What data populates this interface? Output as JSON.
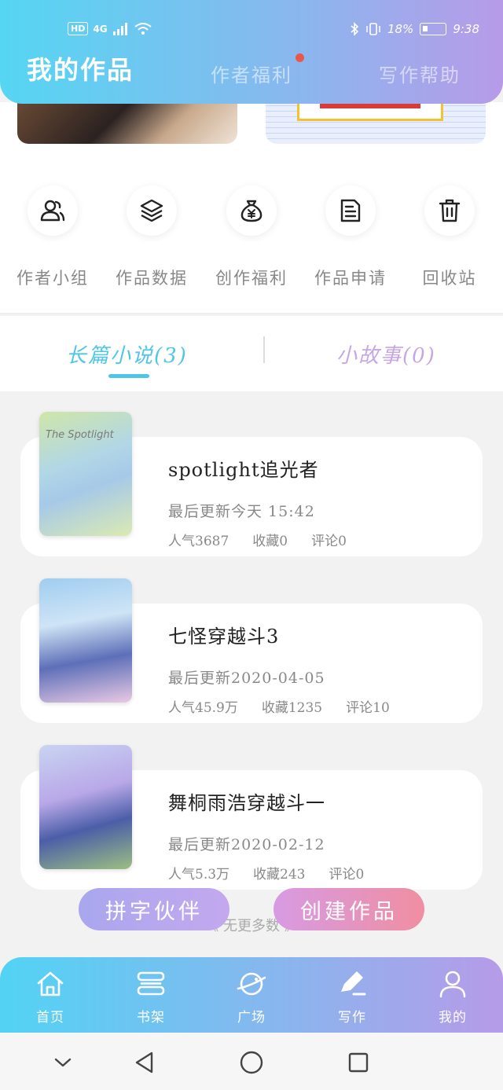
{
  "status_bar": {
    "network_badge": "HD",
    "network_type": "4G",
    "battery_percent": "18%",
    "time": "9:38"
  },
  "header": {
    "tabs": [
      {
        "label": "我的作品",
        "active": true
      },
      {
        "label": "作者福利",
        "active": false,
        "has_dot": true
      },
      {
        "label": "写作帮助",
        "active": false
      }
    ]
  },
  "shortcuts": [
    {
      "label": "作者小组",
      "icon": "users-icon"
    },
    {
      "label": "作品数据",
      "icon": "layers-icon"
    },
    {
      "label": "创作福利",
      "icon": "money-bag-icon"
    },
    {
      "label": "作品申请",
      "icon": "document-icon"
    },
    {
      "label": "回收站",
      "icon": "trash-icon"
    }
  ],
  "subtabs": [
    {
      "label": "长篇小说(3)",
      "active": true
    },
    {
      "label": "小故事(0)",
      "active": false
    }
  ],
  "works": [
    {
      "title": "spotlight追光者",
      "updated": "最后更新今天 15:42",
      "stats": [
        "人气3687",
        "收藏0",
        "评论0"
      ],
      "cover_text": "The Spotlight"
    },
    {
      "title": "七怪穿越斗3",
      "updated": "最后更新2020-04-05",
      "stats": [
        "人气45.9万",
        "收藏1235",
        "评论10"
      ],
      "cover_text": ""
    },
    {
      "title": "舞桐雨浩穿越斗一",
      "updated": "最后更新2020-02-12",
      "stats": [
        "人气5.3万",
        "收藏243",
        "评论0"
      ],
      "cover_text": ""
    }
  ],
  "actions": {
    "partner_label": "拼字伙伴",
    "create_label": "创建作品",
    "load_more": "《 无更多数 》"
  },
  "bottom_nav": [
    {
      "label": "首页",
      "icon": "home-icon"
    },
    {
      "label": "书架",
      "icon": "bookshelf-icon"
    },
    {
      "label": "广场",
      "icon": "planet-icon"
    },
    {
      "label": "写作",
      "icon": "pen-icon",
      "active": true
    },
    {
      "label": "我的",
      "icon": "profile-icon"
    }
  ],
  "colors": {
    "accent_blue": "#4fc6e8",
    "accent_purple": "#c7a6e6",
    "notification_dot": "#e9574a"
  }
}
